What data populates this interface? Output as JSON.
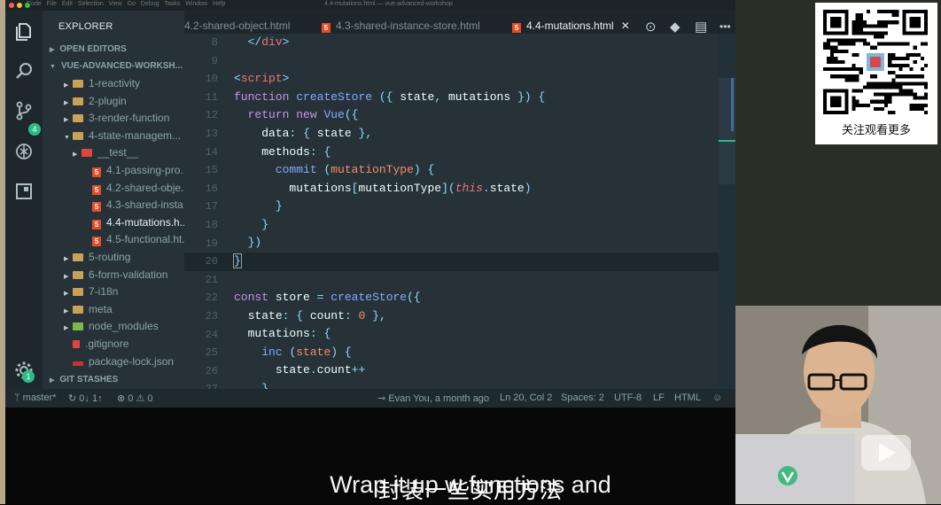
{
  "window": {
    "title": "4.4-mutations.html — vue-advanced-workshop",
    "menu": "Code File Edit Selection View Go Debug Tasks Window Help"
  },
  "activitybar": {
    "scm_badge": "4",
    "settings_badge": "1"
  },
  "sidebar": {
    "title": "EXPLORER",
    "open_editors": "OPEN EDITORS",
    "workspace": "VUE-ADVANCED-WORKSH...",
    "items": [
      {
        "label": "1-reactivity",
        "kind": "folder"
      },
      {
        "label": "2-plugin",
        "kind": "folder"
      },
      {
        "label": "3-render-function",
        "kind": "folder"
      },
      {
        "label": "4-state-managem...",
        "kind": "folder-open"
      },
      {
        "label": "__test__",
        "kind": "test-folder"
      },
      {
        "label": "4.1-passing-pro...",
        "kind": "html"
      },
      {
        "label": "4.2-shared-obje...",
        "kind": "html"
      },
      {
        "label": "4.3-shared-insta...",
        "kind": "html"
      },
      {
        "label": "4.4-mutations.h...",
        "kind": "html-active"
      },
      {
        "label": "4.5-functional.ht...",
        "kind": "html"
      },
      {
        "label": "5-routing",
        "kind": "folder"
      },
      {
        "label": "6-form-validation",
        "kind": "folder"
      },
      {
        "label": "7-i18n",
        "kind": "folder"
      },
      {
        "label": "meta",
        "kind": "folder"
      },
      {
        "label": "node_modules",
        "kind": "folder-green"
      },
      {
        "label": ".gitignore",
        "kind": "git"
      },
      {
        "label": "package-lock.json",
        "kind": "lock"
      }
    ],
    "git_stashes": "GIT STASHES"
  },
  "tabs": [
    {
      "label": "4.2-shared-object.html"
    },
    {
      "label": "4.3-shared-instance-store.html"
    },
    {
      "label": "4.4-mutations.html"
    }
  ],
  "editor": {
    "line_numbers": [
      "8",
      "9",
      "10",
      "11",
      "12",
      "13",
      "14",
      "15",
      "16",
      "17",
      "18",
      "19",
      "20",
      "21",
      "22",
      "23",
      "24",
      "25",
      "26",
      "27"
    ]
  },
  "statusbar": {
    "branch": "master*",
    "sync": "0↓ 1↑",
    "problems": "⊗ 0 ⚠ 0",
    "blame": "Evan You, a month ago",
    "position": "Ln 20, Col 2",
    "spaces": "Spaces: 2",
    "encoding": "UTF-8",
    "eol": "LF",
    "language": "HTML"
  },
  "overlay": {
    "qr_caption": "关注观看更多",
    "subtitle_en": "Wrap it up w                          functions and",
    "subtitle_cn": "封装一些实用方法"
  },
  "colors": {
    "accent": "#2bbc8a",
    "editor_bg": "#263238"
  }
}
